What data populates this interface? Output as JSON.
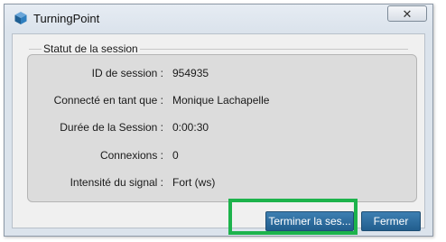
{
  "window": {
    "title": "TurningPoint",
    "close_glyph": "✕",
    "app_icon": "turningpoint-cube-icon"
  },
  "group": {
    "label": "Statut de la session"
  },
  "session_info": [
    {
      "label": "ID de session :",
      "value": "954935"
    },
    {
      "label": "Connecté en tant que :",
      "value": "Monique Lachapelle"
    },
    {
      "label": "Durée de la Session :",
      "value": "0:00:30"
    },
    {
      "label": "Connexions :",
      "value": "0"
    },
    {
      "label": "Intensité du signal :",
      "value": "Fort (ws)"
    }
  ],
  "buttons": {
    "end_session": "Terminer la ses...",
    "close": "Fermer"
  },
  "colors": {
    "button": "#2c6a9a",
    "highlight": "#1db34c"
  }
}
